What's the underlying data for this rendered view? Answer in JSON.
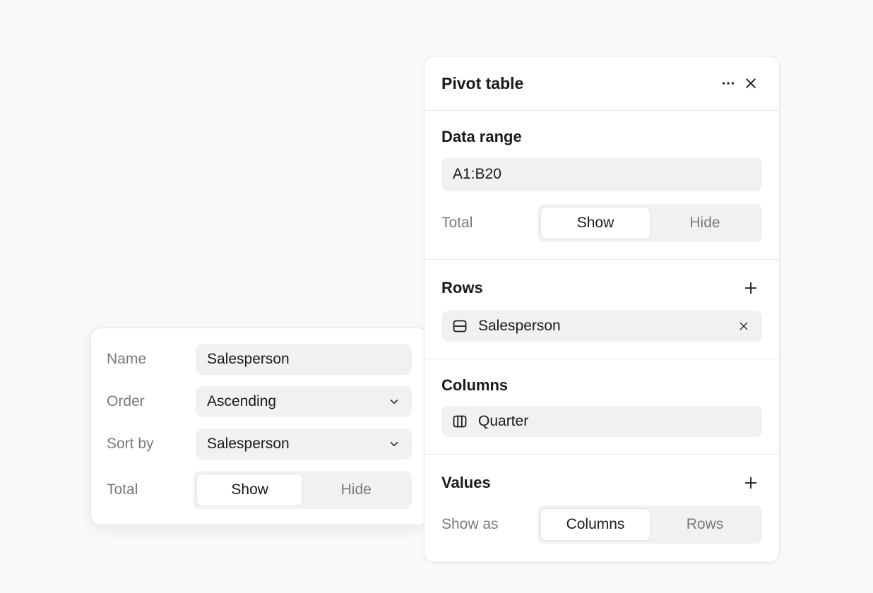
{
  "panel": {
    "title": "Pivot table",
    "more_icon": "more-horizontal",
    "close_icon": "close",
    "data_range": {
      "title": "Data range",
      "value": "A1:B20",
      "total_label": "Total",
      "toggle": {
        "show": "Show",
        "hide": "Hide",
        "active": "show"
      }
    },
    "rows": {
      "title": "Rows",
      "add_icon": "plus",
      "item": {
        "icon": "rows-icon",
        "label": "Salesperson",
        "remove_icon": "close"
      }
    },
    "columns": {
      "title": "Columns",
      "item": {
        "icon": "columns-icon",
        "label": "Quarter"
      }
    },
    "values": {
      "title": "Values",
      "add_icon": "plus",
      "showas_label": "Show as",
      "toggle": {
        "columns": "Columns",
        "rows": "Rows",
        "active": "columns"
      }
    }
  },
  "popover": {
    "name_label": "Name",
    "name_value": "Salesperson",
    "order_label": "Order",
    "order_value": "Ascending",
    "sortby_label": "Sort by",
    "sortby_value": "Salesperson",
    "total_label": "Total",
    "toggle": {
      "show": "Show",
      "hide": "Hide",
      "active": "show"
    }
  }
}
